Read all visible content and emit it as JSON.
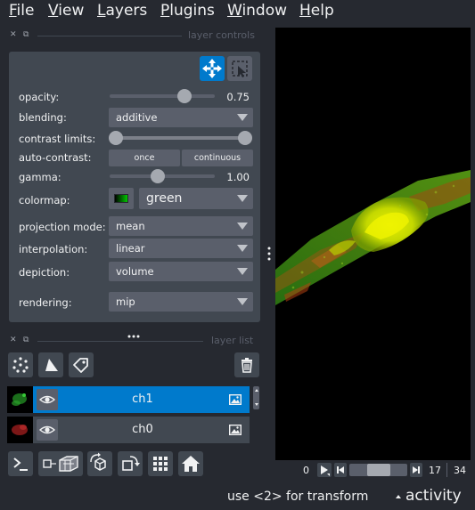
{
  "menu": {
    "items": [
      {
        "first": "F",
        "rest": "ile"
      },
      {
        "first": "V",
        "rest": "iew"
      },
      {
        "first": "L",
        "rest": "ayers"
      },
      {
        "first": "P",
        "rest": "lugins"
      },
      {
        "first": "W",
        "rest": "indow"
      },
      {
        "first": "H",
        "rest": "elp"
      }
    ]
  },
  "docks": {
    "controls_title": "layer controls",
    "list_title": "layer list",
    "close_glyph": "✕",
    "float_glyph": "⧉"
  },
  "controls": {
    "opacity": {
      "label": "opacity:",
      "value": "0.75",
      "fraction": 0.75
    },
    "blending": {
      "label": "blending:",
      "value": "additive"
    },
    "contrast_limits": {
      "label": "contrast limits:",
      "low_fraction": 0.0,
      "high_fraction": 1.0
    },
    "auto_contrast": {
      "label": "auto-contrast:",
      "once": "once",
      "continuous": "continuous"
    },
    "gamma": {
      "label": "gamma:",
      "value": "1.00",
      "fraction": 0.5
    },
    "colormap": {
      "label": "colormap:",
      "value": "green",
      "swatch_color": "#00c800"
    },
    "projection_mode": {
      "label": "projection mode:",
      "value": "mean"
    },
    "interpolation": {
      "label": "interpolation:",
      "value": "linear"
    },
    "depiction": {
      "label": "depiction:",
      "value": "volume"
    },
    "rendering": {
      "label": "rendering:",
      "value": "mip"
    }
  },
  "layers": [
    {
      "name": "ch1",
      "selected": true,
      "thumb_color": "#1e7a1e"
    },
    {
      "name": "ch0",
      "selected": false,
      "thumb_color": "#8a1a1a"
    }
  ],
  "dims": {
    "current": "0",
    "position": "17",
    "total": "34",
    "fraction": 0.5
  },
  "status": {
    "message": "use <2> for transform",
    "activity": "activity"
  },
  "colors": {
    "accent": "#007acc",
    "background": "#262930",
    "panel": "#414851",
    "control": "#5a5f6b"
  },
  "icons": [
    "pan-zoom-icon",
    "transform-icon",
    "new-points-icon",
    "new-shapes-icon",
    "new-labels-icon",
    "delete-layer-icon",
    "eye-icon",
    "image-layer-icon",
    "console-icon",
    "ndisplay-icon",
    "roll-dims-icon",
    "transpose-icon",
    "grid-icon",
    "home-icon",
    "play-icon",
    "step-back-icon",
    "step-forward-icon"
  ]
}
